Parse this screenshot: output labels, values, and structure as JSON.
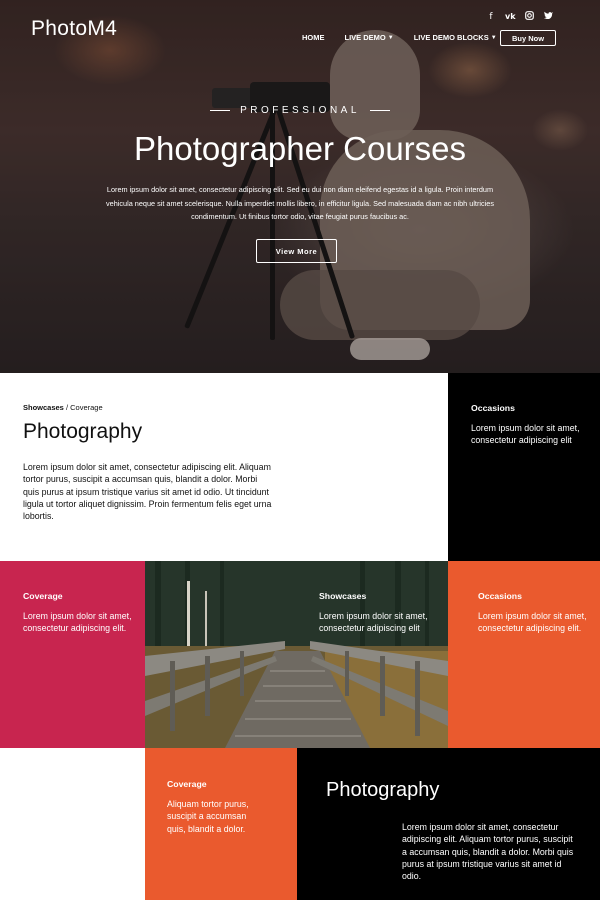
{
  "header": {
    "logo": "PhotoM4",
    "social_icons": [
      "facebook-icon",
      "vk-icon",
      "instagram-icon",
      "twitter-icon"
    ],
    "nav": [
      {
        "label": "HOME",
        "has_caret": false
      },
      {
        "label": "LIVE DEMO",
        "has_caret": true
      },
      {
        "label": "LIVE DEMO BLOCKS",
        "has_caret": true
      }
    ],
    "buy_label": "Buy Now"
  },
  "hero": {
    "eyebrow": "PROFESSIONAL",
    "title": "Photographer Courses",
    "text": "Lorem ipsum dolor sit amet, consectetur adipiscing elit. Sed eu dui non diam eleifend egestas id a ligula. Proin interdum vehicula neque sit amet scelerisque. Nulla imperdiet mollis libero, in efficitur ligula. Sed malesuada diam ac nibh ultricies condimentum. Ut finibus tortor odio, vitae feugiat purus faucibus ac.",
    "button": "View More"
  },
  "intro": {
    "breadcrumb_strong": "Showcases",
    "breadcrumb_rest": " / Coverage",
    "title": "Photography",
    "text": "Lorem ipsum dolor sit amet, consectetur adipiscing elit. Aliquam tortor purus, suscipit a accumsan quis, blandit a dolor. Morbi quis purus at ipsum tristique varius sit amet id odio. Ut tincidunt ligula ut tortor aliquet dignissim. Proin fermentum felis eget urna lobortis."
  },
  "cards": {
    "occasions_top": {
      "title": "Occasions",
      "text": "Lorem ipsum dolor sit amet, consectetur adipiscing elit"
    },
    "coverage": {
      "title": "Coverage",
      "text": "Lorem ipsum dolor sit amet, consectetur adipiscing elit."
    },
    "showcases": {
      "title": "Showcases",
      "text": "Lorem ipsum dolor sit amet, consectetur adipiscing elit"
    },
    "occasions": {
      "title": "Occasions",
      "text": "Lorem ipsum dolor sit amet, consectetur adipiscing elit."
    },
    "coverage_bottom": {
      "title": "Coverage",
      "text": "Aliquam tortor purus, suscipit a accumsan quis, blandit a dolor."
    }
  },
  "bottom": {
    "title": "Photography",
    "text": "Lorem ipsum dolor sit amet, consectetur adipiscing elit. Aliquam tortor purus, suscipit a accumsan quis, blandit a dolor. Morbi quis purus at ipsum tristique varius sit amet id odio."
  },
  "colors": {
    "crimson": "#c8254f",
    "orange": "#ea5a2e",
    "black": "#000000"
  }
}
